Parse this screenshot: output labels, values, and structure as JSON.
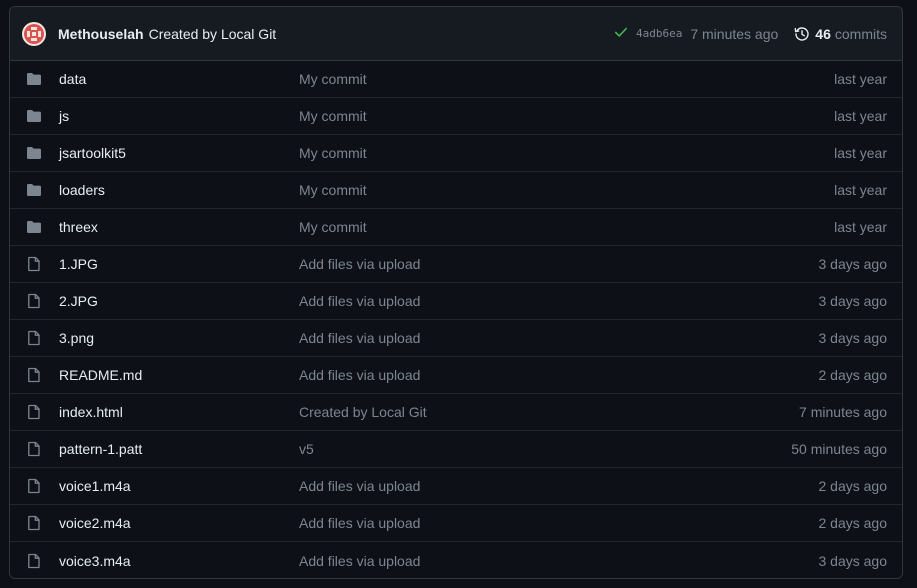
{
  "header": {
    "author": "Methouselah",
    "commit_message": "Created by Local Git",
    "status_icon": "check-icon",
    "sha": "4adb6ea",
    "time": "7 minutes ago",
    "commit_count": "46",
    "commit_word": "commits"
  },
  "rows": [
    {
      "type": "folder",
      "name": "data",
      "message": "My commit",
      "age": "last year"
    },
    {
      "type": "folder",
      "name": "js",
      "message": "My commit",
      "age": "last year"
    },
    {
      "type": "folder",
      "name": "jsartoolkit5",
      "message": "My commit",
      "age": "last year"
    },
    {
      "type": "folder",
      "name": "loaders",
      "message": "My commit",
      "age": "last year"
    },
    {
      "type": "folder",
      "name": "threex",
      "message": "My commit",
      "age": "last year"
    },
    {
      "type": "file",
      "name": "1.JPG",
      "message": "Add files via upload",
      "age": "3 days ago"
    },
    {
      "type": "file",
      "name": "2.JPG",
      "message": "Add files via upload",
      "age": "3 days ago"
    },
    {
      "type": "file",
      "name": "3.png",
      "message": "Add files via upload",
      "age": "3 days ago"
    },
    {
      "type": "file",
      "name": "README.md",
      "message": "Add files via upload",
      "age": "2 days ago"
    },
    {
      "type": "file",
      "name": "index.html",
      "message": "Created by Local Git",
      "age": "7 minutes ago"
    },
    {
      "type": "file",
      "name": "pattern-1.patt",
      "message": "v5",
      "age": "50 minutes ago"
    },
    {
      "type": "file",
      "name": "voice1.m4a",
      "message": "Add files via upload",
      "age": "2 days ago"
    },
    {
      "type": "file",
      "name": "voice2.m4a",
      "message": "Add files via upload",
      "age": "2 days ago"
    },
    {
      "type": "file",
      "name": "voice3.m4a",
      "message": "Add files via upload",
      "age": "3 days ago"
    }
  ],
  "colors": {
    "background": "#0d1117",
    "header_background": "#161b22",
    "border": "#30363d",
    "text": "#e6edf3",
    "muted": "#7d8590",
    "success": "#3fb950",
    "folder_icon": "#7d8590"
  }
}
